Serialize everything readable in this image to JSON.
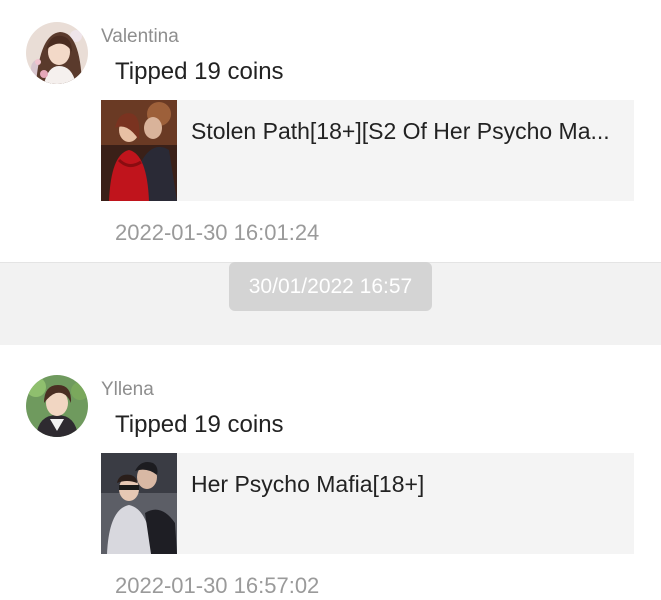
{
  "notifications": [
    {
      "username": "Valentina",
      "message": "Tipped 19 coins",
      "book_title": "Stolen Path[18+][S2 Of Her Psycho Ma...",
      "timestamp": "2022-01-30 16:01:24"
    },
    {
      "username": "Yllena",
      "message": "Tipped 19 coins",
      "book_title": "Her Psycho Mafia[18+]",
      "timestamp": "2022-01-30 16:57:02"
    }
  ],
  "separator": {
    "time_label": "30/01/2022 16:57"
  },
  "colors": {
    "background": "#ffffff",
    "card_background": "#f4f4f4",
    "separator_background": "#f2f2f2",
    "chip_background": "#d4d4d4",
    "primary_text": "#222222",
    "secondary_text": "#8e8e8e"
  }
}
